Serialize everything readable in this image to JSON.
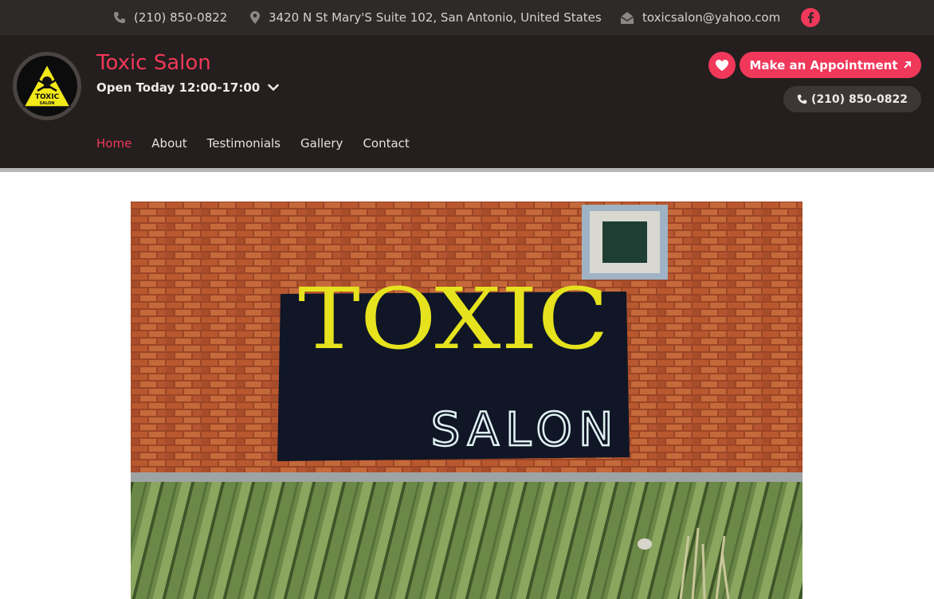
{
  "topbar": {
    "phone": "(210) 850-0822",
    "address": "3420 N St Mary'S Suite 102, San Antonio, United States",
    "email": "toxicsalon@yahoo.com",
    "social_icon": "facebook-icon"
  },
  "header": {
    "title": "Toxic Salon",
    "hours": "Open Today 12:00-17:00",
    "logo_text": "TOXIC",
    "logo_subtext": "SALON",
    "appointment_label": "Make an Appointment",
    "phone_label": "(210) 850-0822"
  },
  "nav": {
    "items": [
      "Home",
      "About",
      "Testimonials",
      "Gallery",
      "Contact"
    ],
    "active": "Home"
  },
  "hero": {
    "sign_line1": "TOXIC",
    "sign_line2": "SALON"
  },
  "colors": {
    "accent": "#f0385a",
    "topbar_bg": "#2e2a29",
    "header_bg": "#241f1e",
    "sign_yellow": "#e6e31e",
    "brick": "#b5532c",
    "roof_green": "#6f8a4a"
  }
}
